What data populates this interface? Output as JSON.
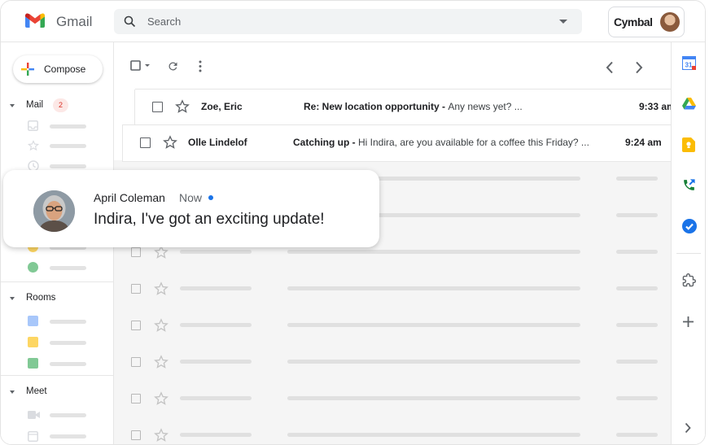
{
  "app": {
    "name": "Gmail"
  },
  "search": {
    "placeholder": "Search"
  },
  "account": {
    "org_label": "Cymbal"
  },
  "sidebar": {
    "compose_label": "Compose",
    "sections": [
      {
        "label": "Mail",
        "badge": "2"
      },
      {
        "label": "Rooms"
      },
      {
        "label": "Meet"
      }
    ]
  },
  "emails": [
    {
      "from": "Zoe, Eric",
      "subject": "Re: New location opportunity",
      "snippet": "Any news yet? ...",
      "time": "9:33 am"
    },
    {
      "from": "Olle Lindelof",
      "subject": "Catching up",
      "snippet": "Hi Indira, are you available for a coffee this Friday? ...",
      "time": "9:24 am"
    }
  ],
  "subject_separator": " - ",
  "notification": {
    "sender": "April Coleman",
    "time": "Now",
    "message": "Indira, I've got an exciting update!"
  },
  "colors": {
    "accent_blue": "#1a73e8",
    "badge_red": "#d93025",
    "search_bg": "#f1f3f4"
  },
  "icons": {
    "header": [
      "gmail-logo",
      "search-icon",
      "search-options-icon",
      "account-avatar"
    ],
    "toolbar": [
      "select-all-checkbox",
      "refresh-icon",
      "more-vert-icon",
      "prev-page-icon",
      "next-page-icon"
    ],
    "rail": [
      "calendar-icon",
      "drive-icon",
      "keep-icon",
      "voice-icon",
      "tasks-icon",
      "addons-icon",
      "add-icon",
      "expand-panel-icon"
    ]
  }
}
